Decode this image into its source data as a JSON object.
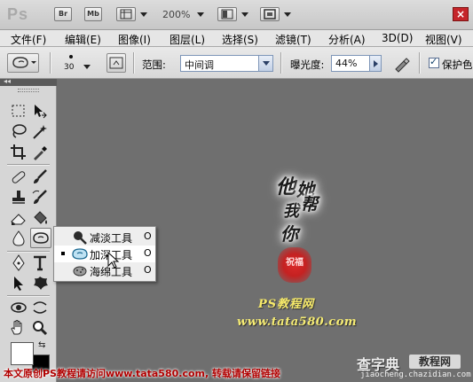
{
  "app": {
    "logo": "Ps"
  },
  "appbar": {
    "bridge_label": "Br",
    "minibridge_label": "Mb",
    "zoom": "200%",
    "close_label": "×"
  },
  "menu": [
    "文件(F)",
    "编辑(E)",
    "图像(I)",
    "图层(L)",
    "选择(S)",
    "滤镜(T)",
    "分析(A)",
    "3D(D)",
    "视图(V)"
  ],
  "options": {
    "brush_size": "30",
    "range_label": "范围:",
    "range_value": "中间调",
    "exposure_label": "曝光度:",
    "exposure_value": "44%",
    "protect_label": "保护色",
    "protect_checked": true
  },
  "flyout": {
    "items": [
      {
        "label": "减淡工具",
        "shortcut": "O",
        "icon": "dodge-icon",
        "active": false
      },
      {
        "label": "加深工具",
        "shortcut": "O",
        "icon": "burn-icon",
        "active": true
      },
      {
        "label": "海绵工具",
        "shortcut": "O",
        "icon": "sponge-icon",
        "active": false
      }
    ]
  },
  "artwork": {
    "words": [
      "他",
      "她",
      "我",
      "帮",
      "你"
    ],
    "seal_text": "祝福",
    "site_name": "PS教程网",
    "url": "www.tata580.com"
  },
  "colors": {
    "foreground": "#ffffff",
    "background": "#000000",
    "accent_blue": "#7e96b8"
  },
  "footer": {
    "text": "本文原创PS教程请访问www.tata580.com, 转载请保留链接",
    "watermark_title": "查字典",
    "watermark_tag": "教程网",
    "watermark_url": "jiaocheng.chazidian.com"
  }
}
